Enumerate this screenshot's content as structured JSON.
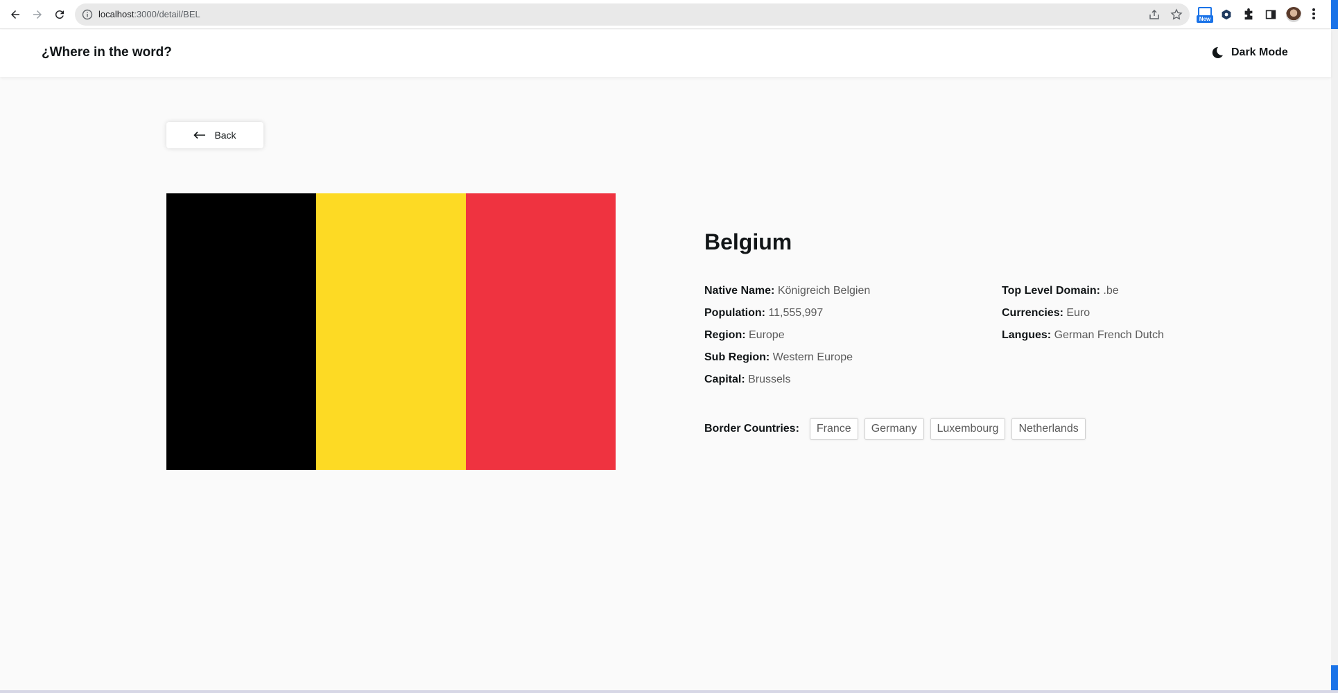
{
  "browser": {
    "url_host": "localhost",
    "url_path": ":3000/detail/BEL",
    "new_badge": "New"
  },
  "header": {
    "title": "¿Where in the word?",
    "dark_mode_label": "Dark Mode"
  },
  "back_label": "Back",
  "country": {
    "name": "Belgium",
    "flag_colors": [
      "#000000",
      "#FDDA24",
      "#EF3340"
    ],
    "left_fields": [
      {
        "label": "Native Name:",
        "value": "Königreich Belgien"
      },
      {
        "label": "Population:",
        "value": "11,555,997"
      },
      {
        "label": "Region:",
        "value": "Europe"
      },
      {
        "label": "Sub Region:",
        "value": "Western Europe"
      },
      {
        "label": "Capital:",
        "value": "Brussels"
      }
    ],
    "right_fields": [
      {
        "label": "Top Level Domain:",
        "value": ".be"
      },
      {
        "label": "Currencies:",
        "value": "Euro"
      },
      {
        "label": "Langues:",
        "value": "German French Dutch"
      }
    ],
    "border_label": "Border Countries:",
    "borders": [
      "France",
      "Germany",
      "Luxembourg",
      "Netherlands"
    ]
  },
  "icons": {
    "back": "arrow-left-icon",
    "forward": "arrow-right-icon",
    "reload": "reload-icon",
    "site_info": "info-icon",
    "share": "share-icon",
    "bookmark": "star-icon",
    "extensions": "puzzle-icon",
    "side_panel": "side-panel-icon",
    "menu": "kebab-menu-icon",
    "dark_mode": "moon-icon",
    "back_button": "arrow-left-icon"
  }
}
